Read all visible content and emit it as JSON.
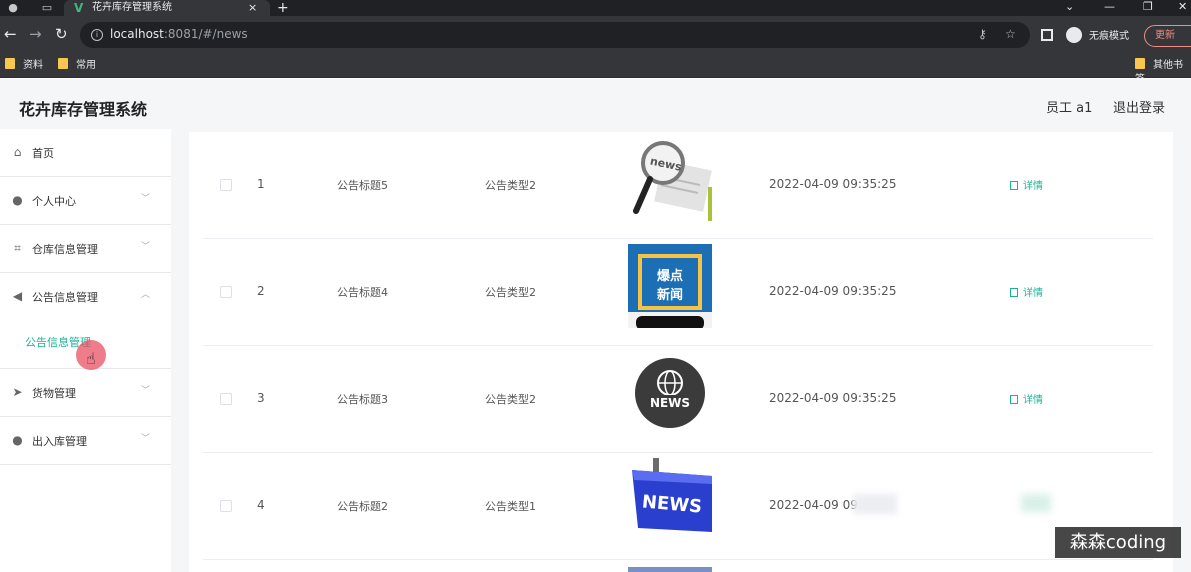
{
  "browser": {
    "tab_title": "花卉库存管理系统",
    "tab_close": "×",
    "new_tab": "+",
    "url_host": "localhost",
    "url_rest": ":8081/#/news",
    "incognito_label": "无痕模式",
    "update_label": "更新",
    "bookmarks": [
      {
        "label": "资料"
      },
      {
        "label": "常用"
      },
      {
        "label": "其他书签"
      }
    ]
  },
  "app": {
    "title": "花卉库存管理系统",
    "user_label": "员工 a1",
    "logout_label": "退出登录"
  },
  "sidebar": {
    "items": [
      {
        "label": "首页",
        "icon": "home-icon"
      },
      {
        "label": "个人中心",
        "icon": "user-icon",
        "arrow": "﹀"
      },
      {
        "label": "仓库信息管理",
        "icon": "crop-icon",
        "arrow": "﹀"
      },
      {
        "label": "公告信息管理",
        "icon": "megaphone-icon",
        "arrow": "︿"
      },
      {
        "label": "货物管理",
        "icon": "send-icon",
        "arrow": "﹀"
      },
      {
        "label": "出入库管理",
        "icon": "user-icon",
        "arrow": "﹀"
      }
    ],
    "submenu_active": "公告信息管理"
  },
  "table": {
    "detail_label": "详情",
    "rows": [
      {
        "index": "1",
        "title": "公告标题5",
        "type": "公告类型2",
        "time": "2022-04-09 09:35:25",
        "image": "news-magnifier-image"
      },
      {
        "index": "2",
        "title": "公告标题4",
        "type": "公告类型2",
        "time": "2022-04-09 09:35:25",
        "image": "breaking-news-phone-image"
      },
      {
        "index": "3",
        "title": "公告标题3",
        "type": "公告类型2",
        "time": "2022-04-09 09:35:25",
        "image": "news-globe-image"
      },
      {
        "index": "4",
        "title": "公告标题2",
        "type": "公告类型1",
        "time": "2022-04-09",
        "image": "news-keyboard-key-image"
      }
    ],
    "row4_blurred_suffix": "09"
  },
  "watermark": "森森coding",
  "colors": {
    "accent": "#1ab394",
    "browser_dark": "#202124",
    "browser_mid": "#35363a"
  }
}
